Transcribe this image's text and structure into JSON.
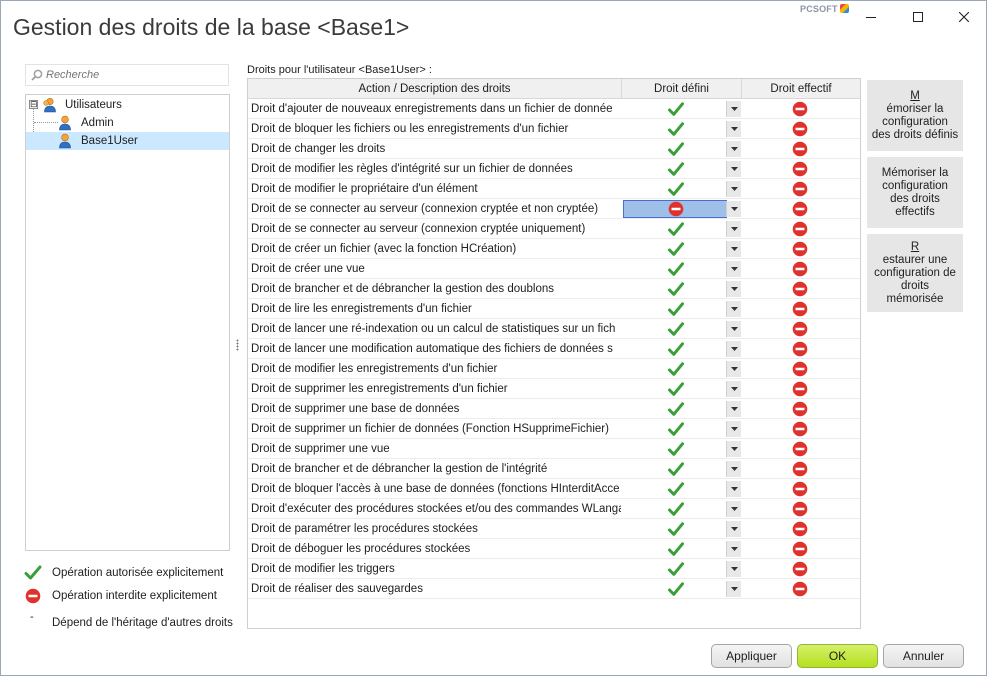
{
  "window": {
    "title": "Gestion des droits de la base <Base1>",
    "brand": "PCSOFT",
    "controls": {
      "minimize": "minimize-icon",
      "maximize": "maximize-icon",
      "close": "close-icon"
    }
  },
  "search": {
    "placeholder": "Recherche"
  },
  "tree": {
    "root": {
      "label": "Utilisateurs",
      "expander": "⊟"
    },
    "children": [
      {
        "label": "Admin"
      },
      {
        "label": "Base1User",
        "selected": true
      }
    ]
  },
  "legend": [
    {
      "icon": "check-icon",
      "text": "Opération autorisée explicitement"
    },
    {
      "icon": "forbidden-icon",
      "text": "Opération interdite explicitement"
    },
    {
      "icon": "inherit-icon",
      "text": "Dépend de l'héritage d'autres droits",
      "glyph": "-"
    }
  ],
  "grid": {
    "caption": "Droits pour l'utilisateur <Base1User> :",
    "headers": {
      "action": "Action / Description des droits",
      "defined": "Droit défini",
      "effective": "Droit effectif"
    },
    "selected_row": 5,
    "rows": [
      {
        "action": "Droit d'ajouter de nouveaux enregistrements dans un fichier de donnée",
        "defined": "check",
        "effective": "forbidden"
      },
      {
        "action": "Droit de bloquer les fichiers ou les enregistrements d'un fichier",
        "defined": "check",
        "effective": "forbidden"
      },
      {
        "action": "Droit de changer les droits",
        "defined": "check",
        "effective": "forbidden"
      },
      {
        "action": "Droit de modifier les règles d'intégrité sur un fichier de données",
        "defined": "check",
        "effective": "forbidden"
      },
      {
        "action": "Droit de modifier le propriétaire d'un élément",
        "defined": "check",
        "effective": "forbidden"
      },
      {
        "action": "Droit de se connecter au serveur (connexion cryptée et non cryptée)",
        "defined": "forbidden",
        "effective": "forbidden"
      },
      {
        "action": "Droit de se connecter au serveur (connexion cryptée uniquement)",
        "defined": "check",
        "effective": "forbidden"
      },
      {
        "action": "Droit de créer un fichier (avec la fonction HCréation)",
        "defined": "check",
        "effective": "forbidden"
      },
      {
        "action": "Droit de créer une vue",
        "defined": "check",
        "effective": "forbidden"
      },
      {
        "action": "Droit de brancher et de débrancher la gestion des doublons",
        "defined": "check",
        "effective": "forbidden"
      },
      {
        "action": "Droit de lire les enregistrements d'un fichier",
        "defined": "check",
        "effective": "forbidden"
      },
      {
        "action": "Droit de lancer une ré-indexation ou un calcul de statistiques sur un fich",
        "defined": "check",
        "effective": "forbidden"
      },
      {
        "action": "Droit de lancer une modification automatique des fichiers de données s",
        "defined": "check",
        "effective": "forbidden"
      },
      {
        "action": "Droit de modifier les enregistrements d'un fichier",
        "defined": "check",
        "effective": "forbidden"
      },
      {
        "action": "Droit de supprimer les enregistrements d'un fichier",
        "defined": "check",
        "effective": "forbidden"
      },
      {
        "action": "Droit de supprimer une base de données",
        "defined": "check",
        "effective": "forbidden"
      },
      {
        "action": "Droit de supprimer un fichier de données (Fonction HSupprimeFichier)",
        "defined": "check",
        "effective": "forbidden"
      },
      {
        "action": "Droit de supprimer une vue",
        "defined": "check",
        "effective": "forbidden"
      },
      {
        "action": "Droit de brancher et de débrancher la gestion de l'intégrité",
        "defined": "check",
        "effective": "forbidden"
      },
      {
        "action": "Droit de bloquer l'accès à une base de données (fonctions HInterditAcce",
        "defined": "check",
        "effective": "forbidden"
      },
      {
        "action": "Droit d'exécuter des procédures stockées et/ou des commandes WLanga",
        "defined": "check",
        "effective": "forbidden"
      },
      {
        "action": "Droit de paramétrer les procédures stockées",
        "defined": "check",
        "effective": "forbidden"
      },
      {
        "action": "Droit de déboguer les procédures stockées",
        "defined": "check",
        "effective": "forbidden"
      },
      {
        "action": "Droit de modifier les triggers",
        "defined": "check",
        "effective": "forbidden"
      },
      {
        "action": "Droit de réaliser des sauvegardes",
        "defined": "check",
        "effective": "forbidden"
      }
    ]
  },
  "side_buttons": [
    {
      "lines": [
        "Mémoriser la",
        "configuration",
        "des droits définis"
      ],
      "mnemonic": "M"
    },
    {
      "lines": [
        "Mémoriser la",
        "configuration",
        "des droits",
        "effectifs"
      ]
    },
    {
      "lines": [
        "Restaurer une",
        "configuration de",
        "droits mémorisée"
      ],
      "mnemonic": "R"
    }
  ],
  "footer": {
    "apply": "Appliquer",
    "ok": "OK",
    "cancel": "Annuler"
  },
  "colors": {
    "check": "#3a9e3a",
    "forbidden": "#e0322d",
    "ok_button": "#b4e01f",
    "selection": "#9ec0e8",
    "tree_selection": "#cce8ff"
  }
}
